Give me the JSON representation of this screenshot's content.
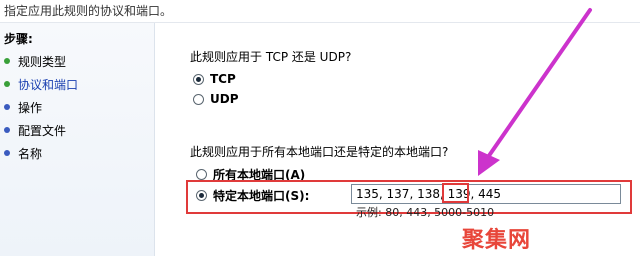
{
  "window": {
    "title": "指定应用此规则的协议和端口。"
  },
  "sidebar": {
    "header": "步骤:",
    "steps": [
      {
        "label": "规则类型",
        "status": "done"
      },
      {
        "label": "协议和端口",
        "status": "active"
      },
      {
        "label": "操作",
        "status": "todo"
      },
      {
        "label": "配置文件",
        "status": "todo"
      },
      {
        "label": "名称",
        "status": "todo"
      }
    ]
  },
  "main": {
    "protocol_question": "此规则应用于 TCP 还是 UDP?",
    "protocol_options": [
      {
        "label": "TCP",
        "selected": true
      },
      {
        "label": "UDP",
        "selected": false
      }
    ],
    "port_question": "此规则应用于所有本地端口还是特定的本地端口?",
    "port_options": [
      {
        "label": "所有本地端口(A)",
        "selected": false
      },
      {
        "label": "特定本地端口(S):",
        "selected": true
      }
    ],
    "port_value": "135, 137, 138, 139, 445",
    "port_example": "示例: 80, 443, 5000-5010"
  },
  "watermark": "聚集网",
  "colors": {
    "annotation": "#e03a3a",
    "arrow": "#cc33cc",
    "done_bullet": "#39a039",
    "todo_bullet": "#3a5bbf"
  }
}
